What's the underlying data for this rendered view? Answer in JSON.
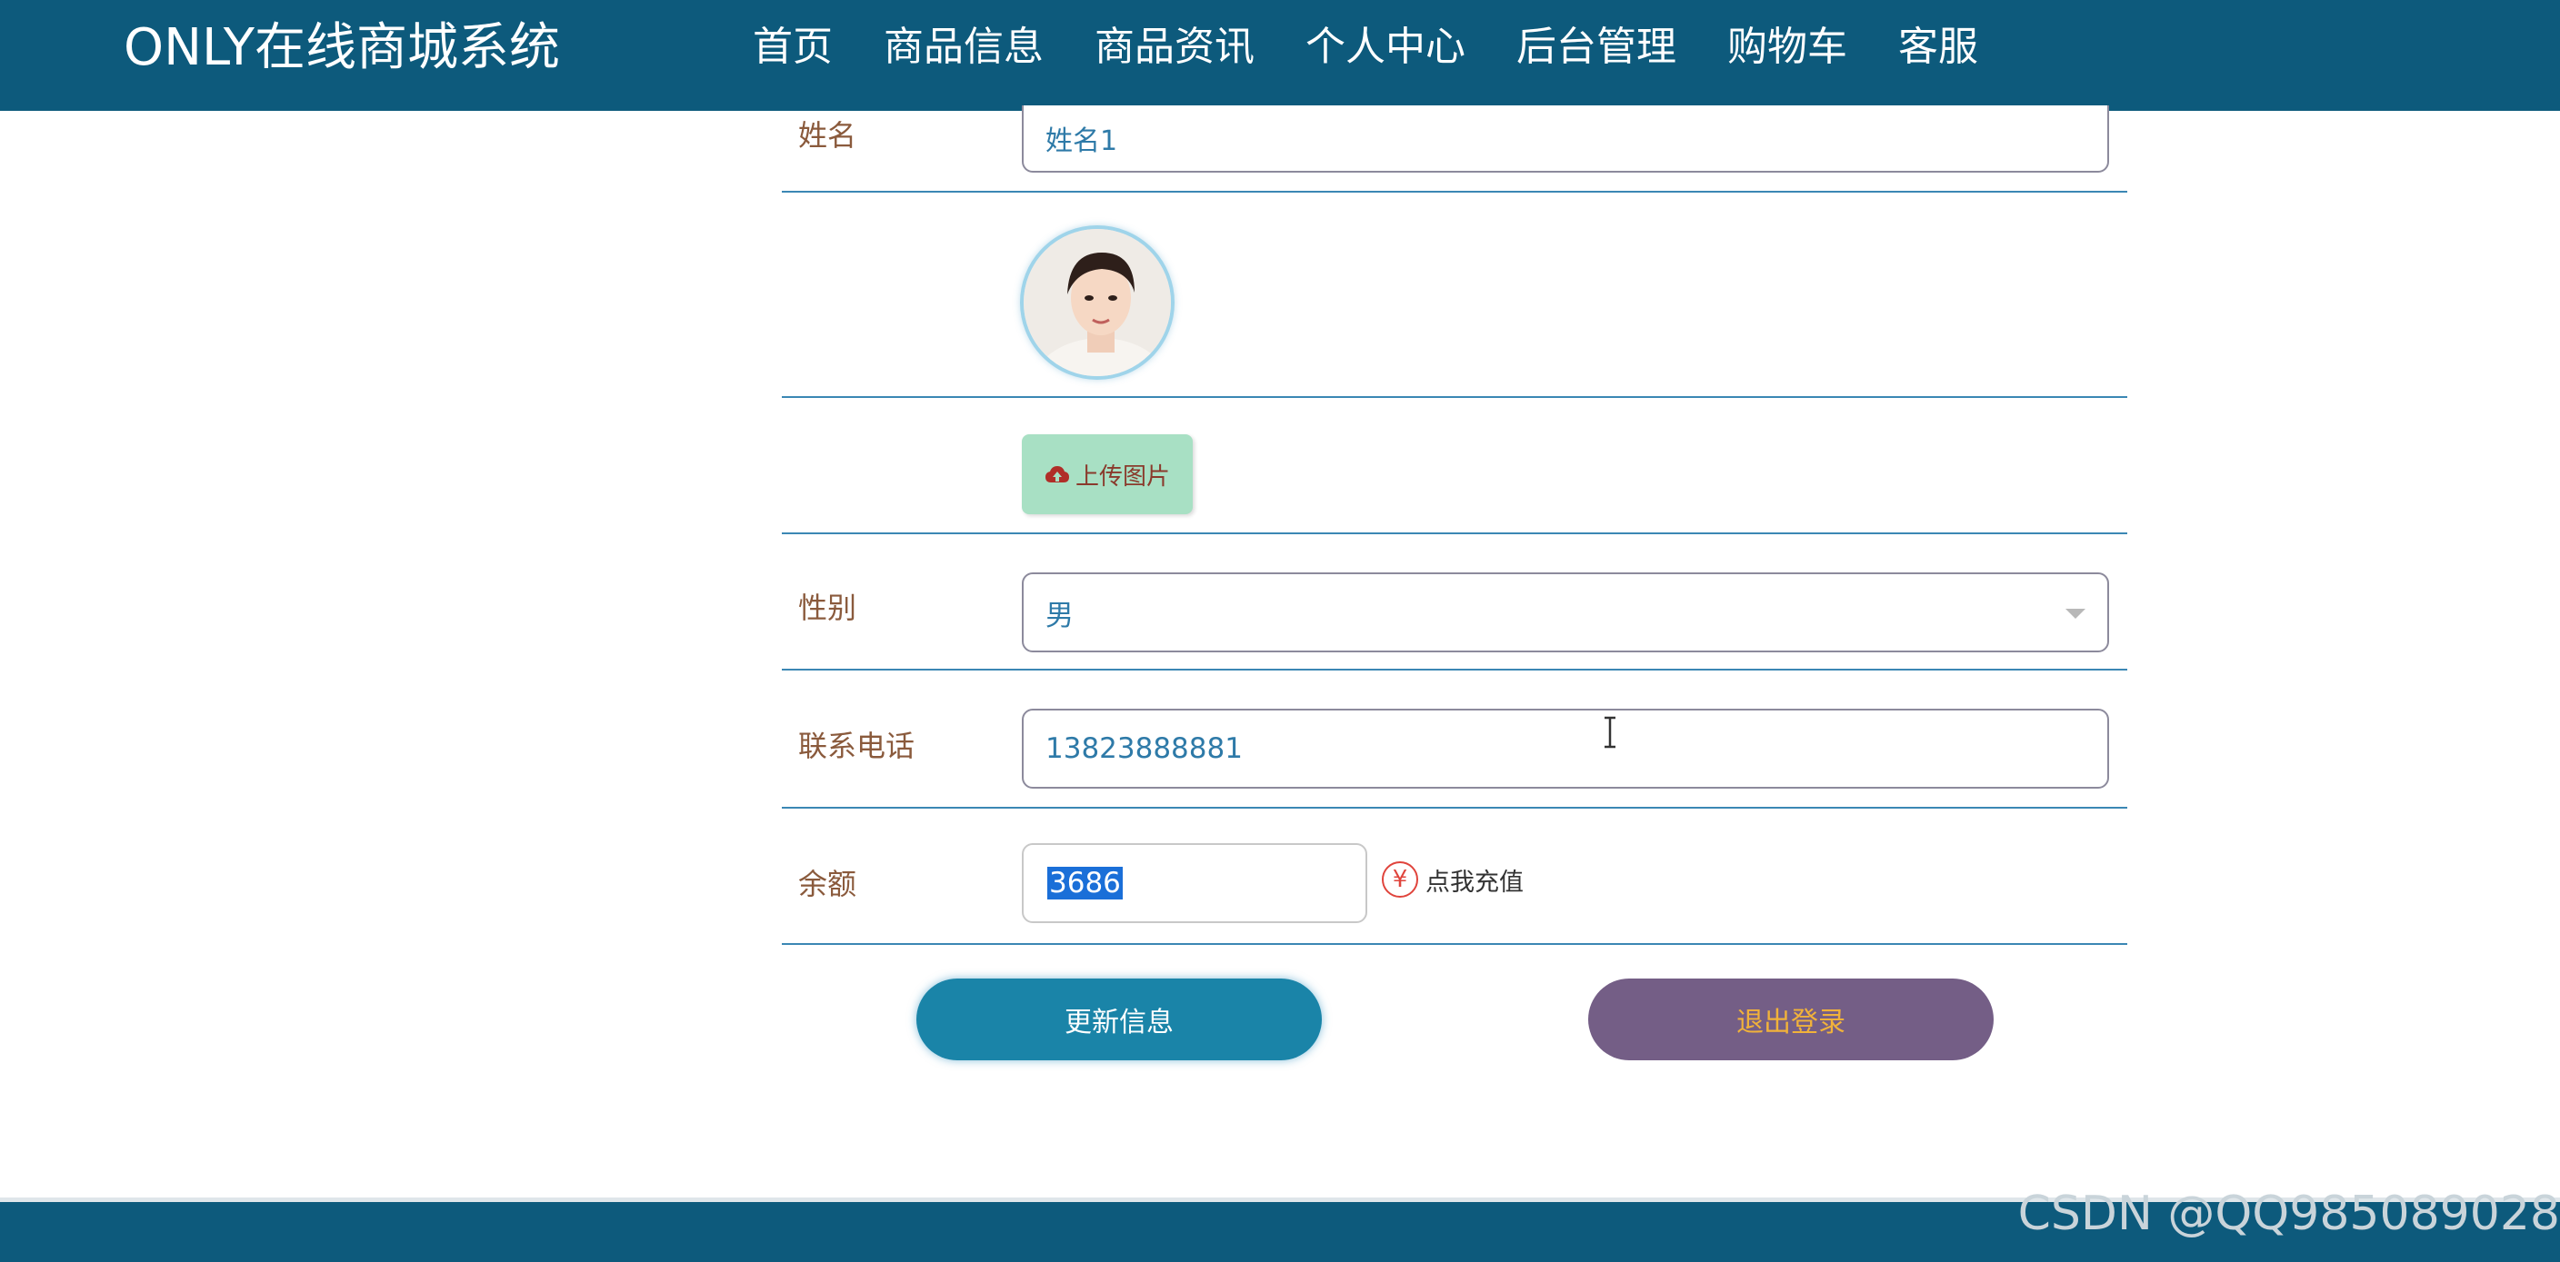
{
  "header": {
    "site_title": "ONLY在线商城系统",
    "nav": [
      "首页",
      "商品信息",
      "商品资讯",
      "个人中心",
      "后台管理",
      "购物车",
      "客服"
    ],
    "active_nav": "个人中心"
  },
  "form": {
    "name_label": "姓名",
    "name_value": "姓名1",
    "upload_label": "上传图片",
    "gender_label": "性别",
    "gender_value": "男",
    "phone_label": "联系电话",
    "phone_value": "13823888881",
    "balance_label": "余额",
    "balance_value": "3686",
    "recharge_label": "点我充值",
    "recharge_icon_text": "¥"
  },
  "actions": {
    "update_label": "更新信息",
    "logout_label": "退出登录"
  },
  "watermark": "CSDN @QQ985089028",
  "colors": {
    "header_bg": "#0d5a7c",
    "update_btn": "#1a84a8",
    "logout_btn": "#745e86",
    "logout_text": "#f1b23a",
    "upload_btn": "#a8e0c4"
  },
  "icons": {
    "upload": "cloud-upload-icon",
    "recharge": "yen-icon",
    "select": "chevron-down-icon"
  }
}
